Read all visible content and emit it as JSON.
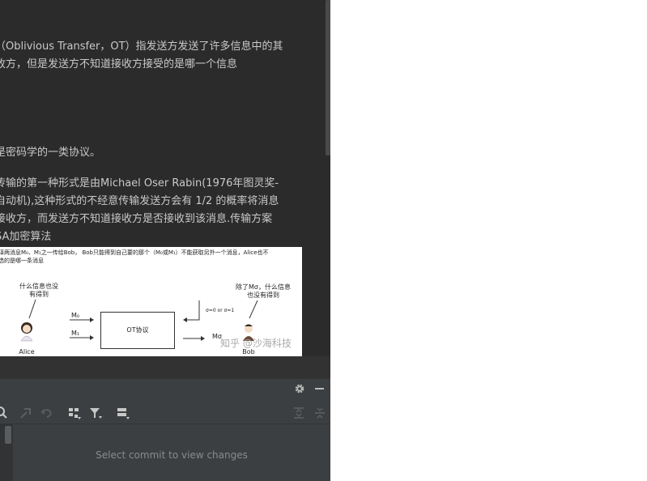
{
  "article": {
    "p1_line1": "（Oblivious Transfer，OT）指发送方发送了许多信息中的其",
    "p1_line2": "收方，但是发送方不知道接收方接受的是哪一个信息",
    "p2": "是密码学的一类协议。",
    "p3_line1": "传输的第一种形式是由Michael Oser Rabin(1976年图灵奖-",
    "p3_line2": "自动机),这种形式的不经意传输发送方会有 1/2 的概率将消息",
    "p3_line3": "接收方，而发送方不知道接收方是否接收到该消息.传输方案",
    "p3_line4": "SA加密算法"
  },
  "figure": {
    "caption_line1": "译两消息M₀、M₁之一传给Bob，  Bob只能得到自己要的那个（M₀或M₁）不能获取另外一个消息，Alice也不",
    "caption_line2": "选的是哪一条消息",
    "alice_note_line1": "什么信息也没",
    "alice_note_line2": "有得到",
    "alice_name": "Alice",
    "m0": "M₀",
    "m1": "M₁",
    "box_label": "OT协议",
    "choice": "σ=0 or σ=1",
    "m_sigma": "Mσ",
    "bob_note_line1": "除了Mσ，什么信息",
    "bob_note_line2": "也没有得到",
    "bob_name": "Bob",
    "watermark": "知乎 @沙海科技"
  },
  "vcs_panel": {
    "empty_message": "Select commit to view changes",
    "header_icons": [
      "gear-icon",
      "minimize-icon"
    ],
    "toolbar_icons": [
      "search-icon",
      "cherry-pick-icon",
      "revert-icon",
      "group-icon",
      "filter-icon",
      "layout-icon",
      "expand-all-icon",
      "collapse-all-icon"
    ]
  },
  "colors": {
    "editor_bg": "#2b2b2b",
    "panel_bg": "#3c3f41",
    "text": "#c9c9c9",
    "muted": "#8a8a8a"
  }
}
